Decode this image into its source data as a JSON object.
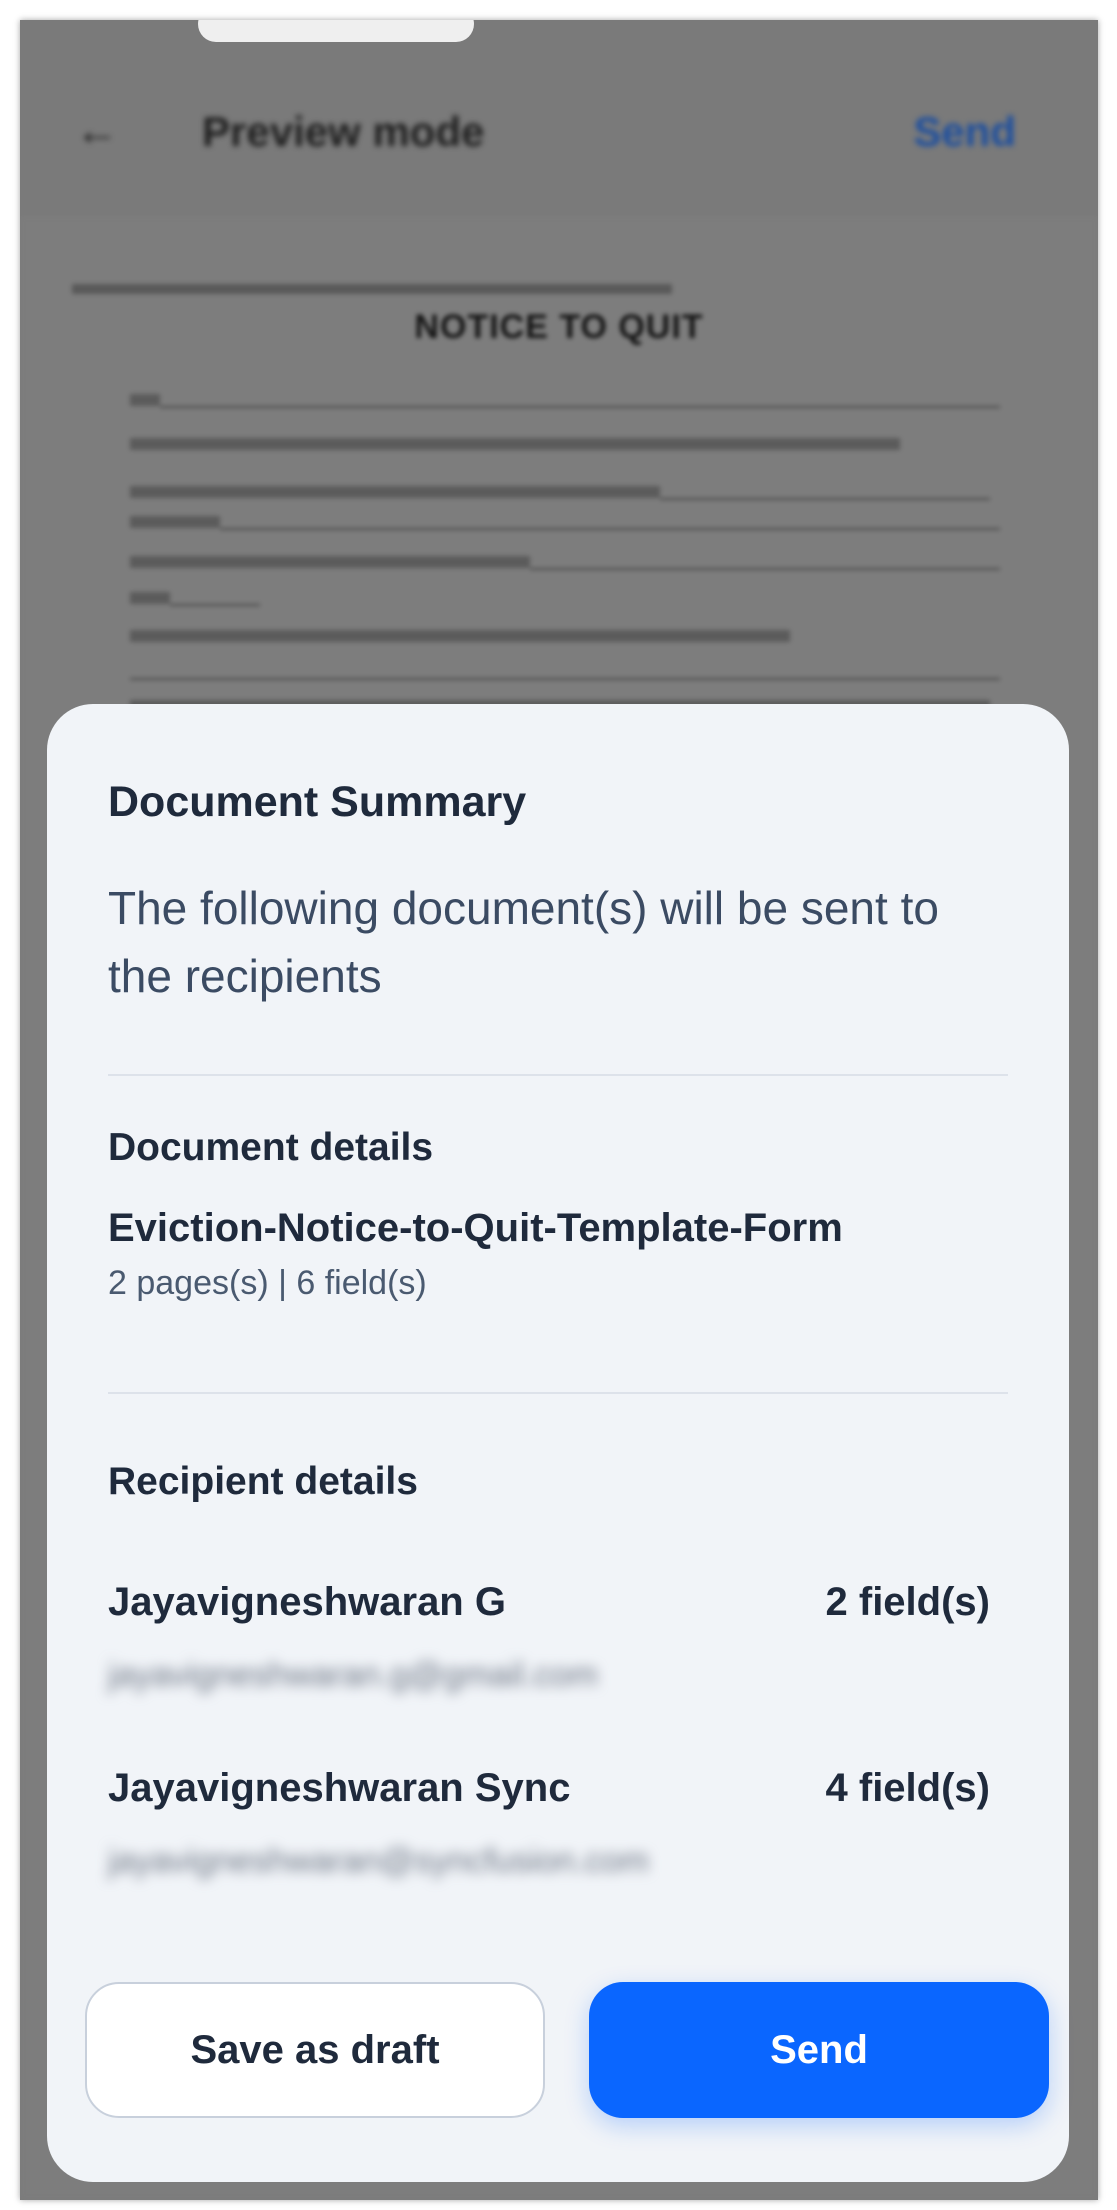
{
  "app_bar": {
    "back_icon": "back-arrow-icon",
    "title": "Preview mode",
    "send_label": "Send"
  },
  "document_preview": {
    "heading": "NOTICE TO QUIT"
  },
  "sheet": {
    "title": "Document Summary",
    "subtitle": "The following document(s) will be sent to the recipients",
    "document_section": {
      "label": "Document details",
      "name": "Eviction-Notice-to-Quit-Template-Form",
      "meta": "2 pages(s) | 6 field(s)"
    },
    "recipient_section": {
      "label": "Recipient details",
      "recipients": [
        {
          "name": "Jayavigneshwaran G",
          "fields": "2 field(s)",
          "email": "jayavigneshwaran.g@gmail.com"
        },
        {
          "name": "Jayavigneshwaran Sync",
          "fields": "4 field(s)",
          "email": "jayavigneshwaran@syncfusion.com"
        }
      ]
    },
    "buttons": {
      "draft_label": "Save as draft",
      "send_label": "Send"
    }
  },
  "colors": {
    "primary": "#0a66ff",
    "sheet_bg": "#f1f4f8",
    "overlay": "#7a7a7a",
    "text_dark": "#1f2a3c"
  }
}
